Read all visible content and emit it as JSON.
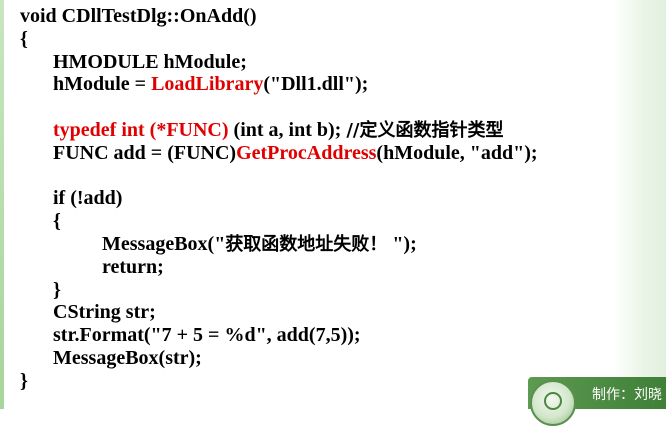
{
  "code": {
    "lines": [
      {
        "indent": 0,
        "parts": [
          {
            "text": "void CDllTestDlg::OnAdd()",
            "style": "normal"
          }
        ]
      },
      {
        "indent": 0,
        "parts": [
          {
            "text": "{",
            "style": "normal"
          }
        ]
      },
      {
        "indent": 1,
        "parts": [
          {
            "text": "HMODULE hModule;",
            "style": "normal"
          }
        ]
      },
      {
        "indent": 1,
        "parts": [
          {
            "text": "hModule = ",
            "style": "normal"
          },
          {
            "text": "LoadLibrary",
            "style": "red"
          },
          {
            "text": "(\"Dll1.dll\");",
            "style": "normal"
          }
        ]
      },
      {
        "indent": 0,
        "parts": []
      },
      {
        "indent": 1,
        "parts": [
          {
            "text": "typedef int (*FUNC) ",
            "style": "red"
          },
          {
            "text": "(int a, int b); ",
            "style": "normal"
          },
          {
            "text": "//定义函数指针类型",
            "style": "cjk"
          }
        ]
      },
      {
        "indent": 1,
        "parts": [
          {
            "text": "FUNC add = (FUNC)",
            "style": "normal"
          },
          {
            "text": "GetProcAddress",
            "style": "red"
          },
          {
            "text": "(hModule, \"add\");",
            "style": "normal"
          }
        ]
      },
      {
        "indent": 0,
        "parts": []
      },
      {
        "indent": 1,
        "parts": [
          {
            "text": "if (!add)",
            "style": "normal"
          }
        ]
      },
      {
        "indent": 1,
        "parts": [
          {
            "text": "{",
            "style": "normal"
          }
        ]
      },
      {
        "indent": 2,
        "parts": [
          {
            "text": "MessageBox(\"",
            "style": "normal"
          },
          {
            "text": "获取函数地址失败！",
            "style": "cjk"
          },
          {
            "text": " \");",
            "style": "normal"
          }
        ]
      },
      {
        "indent": 2,
        "parts": [
          {
            "text": "return;",
            "style": "normal"
          }
        ]
      },
      {
        "indent": 1,
        "parts": [
          {
            "text": "}",
            "style": "normal"
          }
        ]
      },
      {
        "indent": 1,
        "parts": [
          {
            "text": "CString str;",
            "style": "normal"
          }
        ]
      },
      {
        "indent": 1,
        "parts": [
          {
            "text": "str.Format(\"7 + 5 = %d\", add(7,5));",
            "style": "normal"
          }
        ]
      },
      {
        "indent": 1,
        "parts": [
          {
            "text": "MessageBox(str);",
            "style": "normal"
          }
        ]
      },
      {
        "indent": 0,
        "parts": [
          {
            "text": "}",
            "style": "normal"
          }
        ]
      }
    ]
  },
  "footer": {
    "author_label": "制作：刘晓"
  },
  "colors": {
    "keyword_red": "#e00000",
    "footer_green": "#4f8c45",
    "background": "#ffffff"
  },
  "icons": {
    "badge": "school-seal-icon"
  }
}
